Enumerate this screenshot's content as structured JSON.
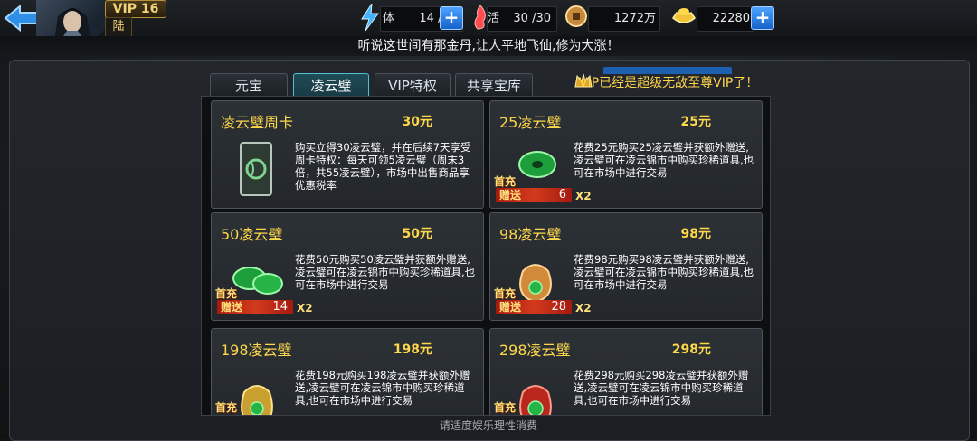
{
  "header": {
    "vip_label": "VIP 16",
    "player_name": "陆",
    "stamina": {
      "label": "体",
      "value": "14 /60"
    },
    "vitality": {
      "label": "活",
      "value": "30 /30"
    },
    "copper": {
      "value": "1272万"
    },
    "gold": {
      "value": "22280"
    },
    "colors": {
      "accent_gold": "#ffd84a",
      "plus_blue": "#1762c9",
      "tab_active": "#4fc0d6"
    },
    "icons": [
      "back-arrow-icon",
      "lightning-icon",
      "vitality-icon",
      "copper-coin-icon",
      "gold-ingot-icon",
      "plus-icon"
    ]
  },
  "announcement": "听说这世间有那金丹,让人平地飞仙,修为大涨！",
  "tabs": [
    {
      "label": "元宝",
      "active": false
    },
    {
      "label": "凌云璧",
      "active": true
    },
    {
      "label": "VIP特权",
      "active": false
    },
    {
      "label": "共享宝库",
      "active": false
    }
  ],
  "vip_message": "VIP已经是超级无敌至尊VIP了！",
  "products": [
    {
      "title": "凌云璧周卡",
      "price": "30元",
      "desc": "购买立得30凌云璧，并在后续7天享受周卡特权：每天可领5凌云璧（周末3倍，共55凌云璧），市场中出售商品享优惠税率"
    },
    {
      "title": "25凌云璧",
      "price": "25元",
      "desc": "花费25元购买25凌云璧并获额外赠送,凌云璧可在凌云锦市中购买珍稀道具,也可在市场中进行交易",
      "promo": {
        "first": "首充",
        "give": "赠送",
        "qty": "6",
        "mult": "X2"
      }
    },
    {
      "title": "50凌云璧",
      "price": "50元",
      "desc": "花费50元购买50凌云璧并获额外赠送,凌云璧可在凌云锦市中购买珍稀道具,也可在市场中进行交易",
      "promo": {
        "first": "首充",
        "give": "赠送",
        "qty": "14",
        "mult": "X2"
      }
    },
    {
      "title": "98凌云璧",
      "price": "98元",
      "desc": "花费98元购买98凌云璧并获额外赠送,凌云璧可在凌云锦市中购买珍稀道具,也可在市场中进行交易",
      "promo": {
        "first": "首充",
        "give": "赠送",
        "qty": "28",
        "mult": "X2"
      }
    },
    {
      "title": "198凌云璧",
      "price": "198元",
      "desc": "花费198元购买198凌云璧并获额外赠送,凌云璧可在凌云锦市中购买珍稀道具,也可在市场中进行交易",
      "promo": {
        "first": "首充"
      }
    },
    {
      "title": "298凌云璧",
      "price": "298元",
      "desc": "花费298元购买298凌云璧并获额外赠送,凌云璧可在凌云锦市中购买珍稀道具,也可在市场中进行交易",
      "promo": {
        "first": "首充"
      }
    }
  ],
  "footer_note": "请适度娱乐理性消费"
}
